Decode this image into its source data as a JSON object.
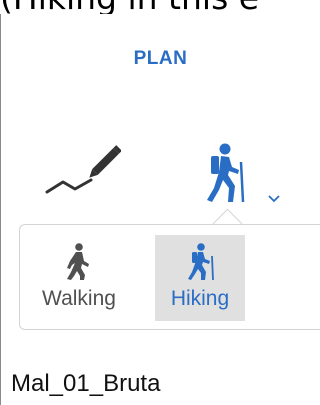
{
  "caption": "(Hiking in this e",
  "panel": {
    "title": "PLAN",
    "mode_options": [
      {
        "label": "Walking",
        "icon": "walking-person-icon",
        "selected": false
      },
      {
        "label": "Hiking",
        "icon": "hiking-person-icon",
        "selected": true
      }
    ],
    "track_name": "Mal_01_Bruta"
  },
  "colors": {
    "accent": "#2a6dc4",
    "icon_gray": "#333333",
    "selected_bg": "#e0e0e0",
    "border": "#d4d4d4"
  },
  "icons": {
    "draw_tool": "pencil-route-icon",
    "current_mode": "hiking-person-icon",
    "dropdown": "chevron-down-icon"
  }
}
